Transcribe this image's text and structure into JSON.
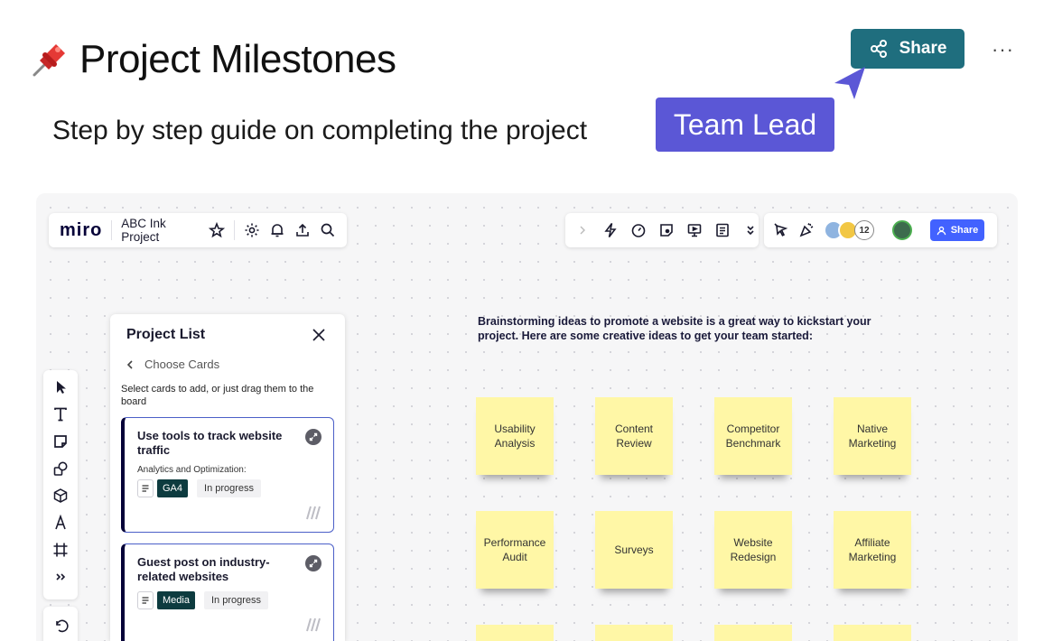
{
  "header": {
    "title": "Project Milestones",
    "subtitle": "Step by step guide on completing the project",
    "share_label": "Share",
    "more_label": "···",
    "cursor_label": "Team Lead"
  },
  "board": {
    "logo": "miro",
    "name": "ABC Ink Project",
    "avatar_count": "12",
    "share_label": "Share",
    "intro": "Brainstorming ideas to promote a website is a great way to kickstart your project. Here are some creative ideas to get your team started:"
  },
  "panel": {
    "title": "Project List",
    "back_label": "Choose Cards",
    "hint": "Select cards to add, or just drag them to the board",
    "cards": [
      {
        "title": "Use tools to track website traffic",
        "category": "Analytics and Optimization:",
        "tag": "GA4",
        "status": "In progress"
      },
      {
        "title": "Guest post on industry-related websites",
        "category": "",
        "tag": "Media",
        "status": "In progress"
      }
    ]
  },
  "stickies": [
    "Usability Analysis",
    "Content Review",
    "Competitor Benchmark",
    "Native Marketing",
    "Performance Audit",
    "Surveys",
    "Website Redesign",
    "Affiliate Marketing"
  ],
  "colors": {
    "share_teal": "#1f6e7e",
    "cursor_purple": "#5b57d6",
    "miro_blue": "#4262ff",
    "sticky_yellow": "#fff7a6",
    "tag_dark": "#0d3b3f"
  },
  "icons": [
    "pushpin-icon",
    "share-icon",
    "cursor-arrow-icon",
    "star-icon",
    "gear-icon",
    "bell-icon",
    "upload-icon",
    "search-icon",
    "lightning-icon",
    "timer-icon",
    "sticky-add-icon",
    "present-icon",
    "notes-icon",
    "chevron-double-down-icon",
    "pointer-icon",
    "celebrate-icon",
    "select-icon",
    "text-icon",
    "sticky-note-icon",
    "shapes-icon",
    "cube-icon",
    "pen-icon",
    "frame-icon",
    "more-tools-icon",
    "undo-icon",
    "close-icon",
    "chevron-left-icon",
    "expand-icon",
    "doc-icon"
  ]
}
